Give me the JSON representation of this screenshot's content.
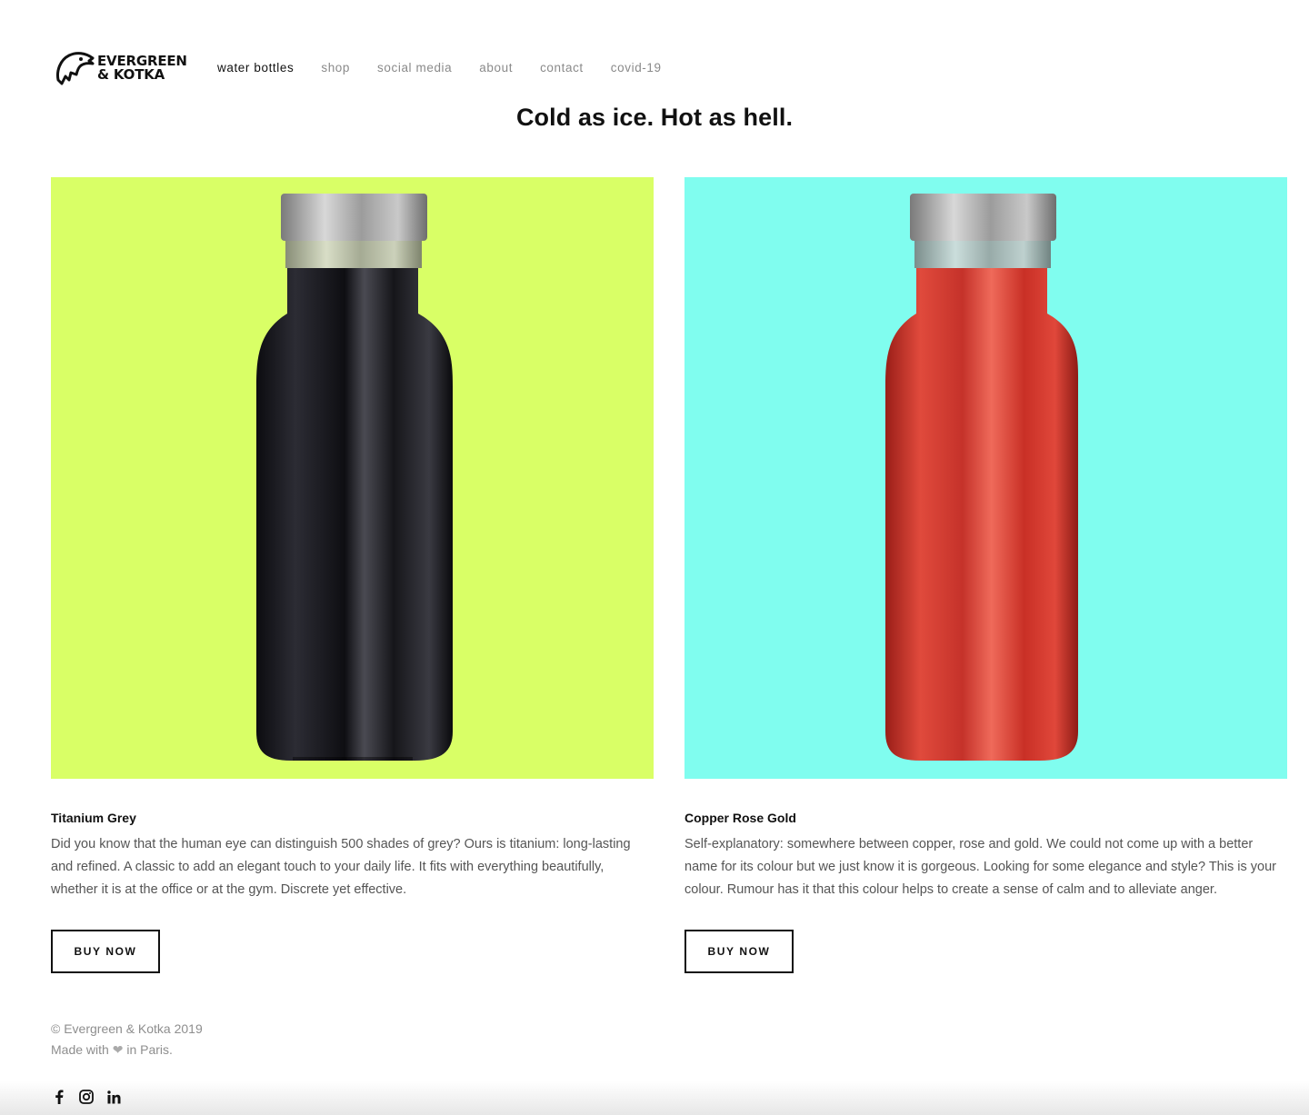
{
  "brand": {
    "line1": "EVERGREEN",
    "line2": "& KOTKA"
  },
  "nav": {
    "items": [
      {
        "label": "water bottles",
        "active": true
      },
      {
        "label": "shop",
        "active": false
      },
      {
        "label": "social media",
        "active": false
      },
      {
        "label": "about",
        "active": false
      },
      {
        "label": "contact",
        "active": false
      },
      {
        "label": "covid-19",
        "active": false
      }
    ]
  },
  "headline": "Cold as ice. Hot as hell.",
  "products": [
    {
      "name": "Titanium Grey",
      "description": "Did you know that the human eye can distinguish 500 shades of grey? Ours is titanium: long-lasting and refined. A classic to add an elegant touch to your daily life. It fits with everything beautifully, whether it is at the office or at the gym. Discrete yet effective.",
      "button": "BUY NOW",
      "background_color": "#d9ff66",
      "bottle_color": "#1c1c22"
    },
    {
      "name": "Copper Rose Gold",
      "description": "Self-explanatory: somewhere between copper, rose and gold. We could not come up with a better name for its colour but we just know it is gorgeous. Looking for some elegance and style? This is your colour. Rumour has it that this colour helps to create a sense of calm and to alleviate anger.",
      "button": "BUY NOW",
      "background_color": "#80fdef",
      "bottle_color": "#d43a2e"
    }
  ],
  "footer": {
    "copyright": "© Evergreen & Kotka 2019",
    "made_prefix": "Made with",
    "heart": "❤",
    "made_suffix": "in Paris."
  },
  "social": [
    "facebook-icon",
    "instagram-icon",
    "linkedin-icon"
  ]
}
